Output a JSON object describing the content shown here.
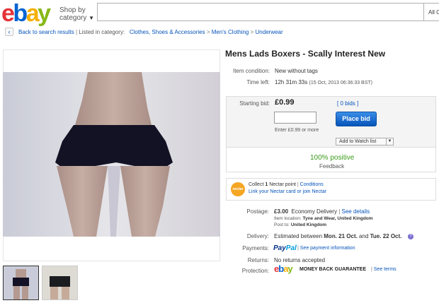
{
  "header": {
    "logo_letters": [
      "e",
      "b",
      "a",
      "y"
    ],
    "shop_by_line1": "Shop by",
    "shop_by_line2": "category",
    "search_placeholder": "",
    "category_select": "All C"
  },
  "breadcrumb": {
    "back_label": "Back to search results",
    "listed_in": "Listed in category:",
    "items": [
      "Clothes, Shoes & Accessories",
      "Men's Clothing",
      "Underwear"
    ]
  },
  "listing": {
    "title": "Mens Lads Boxers - Scally Interest New",
    "condition_label": "Item condition:",
    "condition_value": "New without tags",
    "time_left_label": "Time left:",
    "time_left_value": "12h 31m 33s",
    "time_left_date": "(15 Oct, 2013  06:36:33 BST)",
    "starting_bid_label": "Starting bid:",
    "starting_bid_value": "£0.99",
    "bids_link": "[ 0 bids ]",
    "place_bid_label": "Place bid",
    "enter_hint": "Enter £0.99 or more",
    "watch_label": "Add to Watch list",
    "positive": "100% positive",
    "feedback": "Feedback",
    "nectar_line1_pre": "Collect ",
    "nectar_line1_bold": "1",
    "nectar_line1_post": " Nectar point",
    "nectar_conditions": "Conditions",
    "nectar_line2": "Link your Nectar card or join Nectar",
    "nectar_logo": "nectar",
    "postage_label": "Postage:",
    "postage_price": "£3.00",
    "postage_type": "Economy Delivery",
    "postage_details_link": "See details",
    "item_location_label": "Item location:",
    "item_location_value": "Tyne and Wear, United Kingdom",
    "post_to_label": "Post to:",
    "post_to_value": "United Kingdom",
    "delivery_label": "Delivery:",
    "delivery_pre": "Estimated between ",
    "delivery_from": "Mon. 21 Oct.",
    "delivery_and": " and ",
    "delivery_to": "Tue. 22 Oct.",
    "payments_label": "Payments:",
    "paypal_part1": "Pay",
    "paypal_part2": "Pal",
    "payment_info_link": "See payment information",
    "returns_label": "Returns:",
    "returns_value": "No returns accepted",
    "protection_label": "Protection:",
    "mbg_label": "MONEY BACK GUARANTEE",
    "see_terms_link": "See terms"
  },
  "colors": {
    "link": "#0654ba",
    "positive": "#3a9b1a",
    "button": "#0654ba"
  }
}
